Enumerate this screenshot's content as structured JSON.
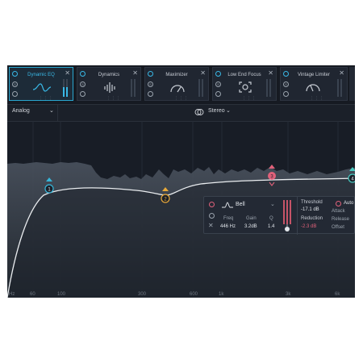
{
  "modules": [
    {
      "name": "Dynamic EQ",
      "active": true,
      "icon": "dynamic-eq-icon"
    },
    {
      "name": "Dynamics",
      "active": false,
      "icon": "dynamics-icon"
    },
    {
      "name": "Maximizer",
      "active": false,
      "icon": "maximizer-icon"
    },
    {
      "name": "Low End Focus",
      "active": false,
      "icon": "low-end-focus-icon"
    },
    {
      "name": "Vintage Limiter",
      "active": false,
      "icon": "vintage-limiter-icon"
    }
  ],
  "module_controls": {
    "close": "✕",
    "solo": "S",
    "dots": "⋮⋮⋮"
  },
  "toolbar": {
    "mode": "Analog",
    "channel": "Stereo",
    "chevron": "⌄"
  },
  "graph": {
    "freq_labels": [
      "Hz",
      "60",
      "100",
      "300",
      "600",
      "1k",
      "3k",
      "6k"
    ],
    "bands": [
      {
        "number": "1",
        "color": "#36b6d9"
      },
      {
        "number": "2",
        "color": "#e8a93a"
      },
      {
        "number": "3",
        "color": "#e0617a"
      },
      {
        "number": "4",
        "color": "#47c9c0"
      }
    ]
  },
  "band_panel": {
    "shape": "Bell",
    "close": "✕",
    "solo": "S",
    "freq_label": "Freq",
    "freq_value": "446 Hz",
    "gain_label": "Gain",
    "gain_value": "3.2dB",
    "q_label": "Q",
    "q_value": "1.4",
    "threshold_label": "Threshold",
    "threshold_value": "-17.1 dB",
    "reduction_label": "Reduction",
    "reduction_value": "-2.3 dB",
    "auto_label": "Auto",
    "attack_label": "Attack",
    "release_label": "Release",
    "offset_label": "Offset",
    "reduction_color": "#e0617a"
  },
  "colors": {
    "accent": "#39b8e6",
    "curve": "#e9ecef",
    "background": "#181d26"
  }
}
